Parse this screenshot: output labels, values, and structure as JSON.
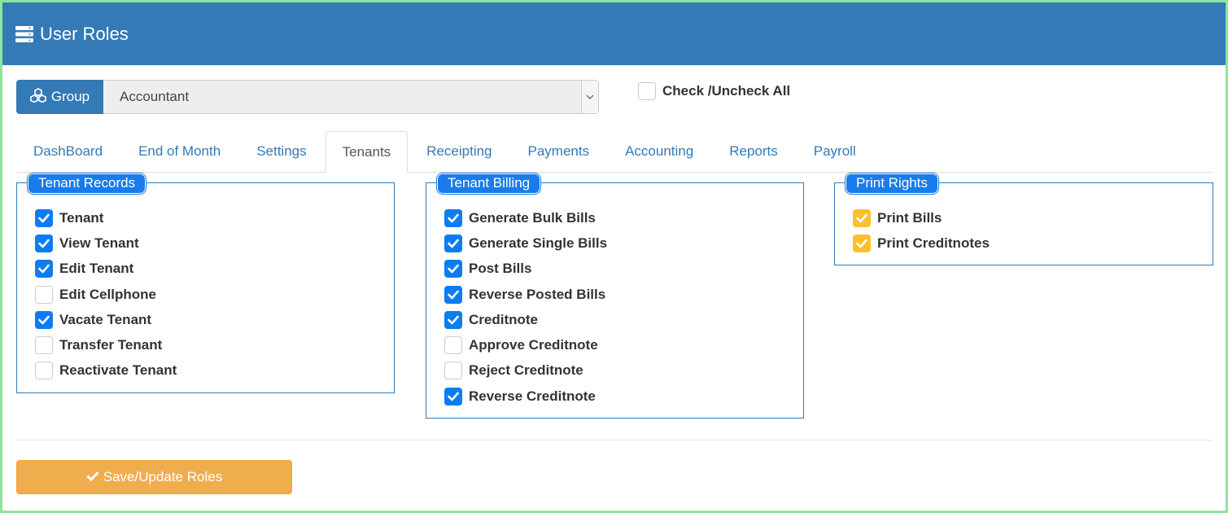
{
  "header": {
    "title": "User Roles",
    "icon": "server-icon",
    "color": "#337ab7"
  },
  "group": {
    "label": "Group",
    "icon": "cubes-icon",
    "selected": "Accountant"
  },
  "check_all": {
    "label": "Check /Uncheck All",
    "checked": false
  },
  "tabs": [
    {
      "label": "DashBoard",
      "active": false
    },
    {
      "label": "End of Month",
      "active": false
    },
    {
      "label": "Settings",
      "active": false
    },
    {
      "label": "Tenants",
      "active": true
    },
    {
      "label": "Receipting",
      "active": false
    },
    {
      "label": "Payments",
      "active": false
    },
    {
      "label": "Accounting",
      "active": false
    },
    {
      "label": "Reports",
      "active": false
    },
    {
      "label": "Payroll",
      "active": false
    }
  ],
  "panels": [
    {
      "title": "Tenant Records",
      "items": [
        {
          "label": "Tenant",
          "checked": true
        },
        {
          "label": "View Tenant",
          "checked": true
        },
        {
          "label": "Edit Tenant",
          "checked": true
        },
        {
          "label": "Edit Cellphone",
          "checked": false
        },
        {
          "label": "Vacate Tenant",
          "checked": true
        },
        {
          "label": "Transfer Tenant",
          "checked": false
        },
        {
          "label": "Reactivate Tenant",
          "checked": false
        }
      ]
    },
    {
      "title": "Tenant Billing",
      "items": [
        {
          "label": "Generate Bulk Bills",
          "checked": true
        },
        {
          "label": "Generate Single Bills",
          "checked": true
        },
        {
          "label": "Post Bills",
          "checked": true
        },
        {
          "label": "Reverse Posted Bills",
          "checked": true
        },
        {
          "label": "Creditnote",
          "checked": true
        },
        {
          "label": "Approve Creditnote",
          "checked": false
        },
        {
          "label": "Reject Creditnote",
          "checked": false
        },
        {
          "label": "Reverse Creditnote",
          "checked": true
        }
      ]
    },
    {
      "title": "Print Rights",
      "items": [
        {
          "label": "Print Bills",
          "checked": true
        },
        {
          "label": "Print Creditnotes",
          "checked": true
        }
      ]
    }
  ],
  "save_button": {
    "label": "Save/Update Roles",
    "icon": "check-icon",
    "color": "#f0ad4e"
  },
  "colors": {
    "checkbox_blue": "#0d7cf2",
    "checkbox_yellow": "#fbc02d",
    "legend_blue": "#1a7ce8"
  }
}
